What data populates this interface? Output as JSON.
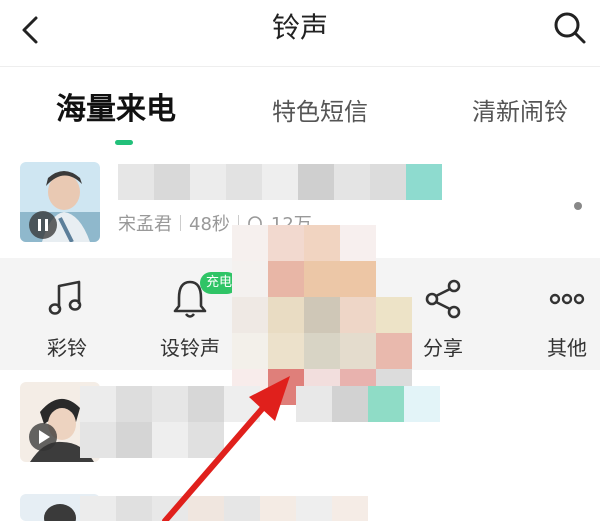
{
  "header": {
    "title": "铃声",
    "back_icon": "chevron-left-icon",
    "search_icon": "search-icon"
  },
  "tabs": [
    {
      "label": "海量来电",
      "active": true
    },
    {
      "label": "特色短信",
      "active": false
    },
    {
      "label": "清新闹铃",
      "active": false
    }
  ],
  "accent_color": "#22c07a",
  "songs": [
    {
      "artist": "宋孟君",
      "duration": "48秒",
      "plays": "12万",
      "state": "paused"
    }
  ],
  "actions": [
    {
      "label": "彩铃",
      "icon": "music-note-icon"
    },
    {
      "label": "设铃声",
      "icon": "bell-icon"
    },
    {
      "label": "分享",
      "icon": "share-icon"
    },
    {
      "label": "其他",
      "icon": "more-icon"
    }
  ],
  "badge": {
    "label": "充电"
  }
}
